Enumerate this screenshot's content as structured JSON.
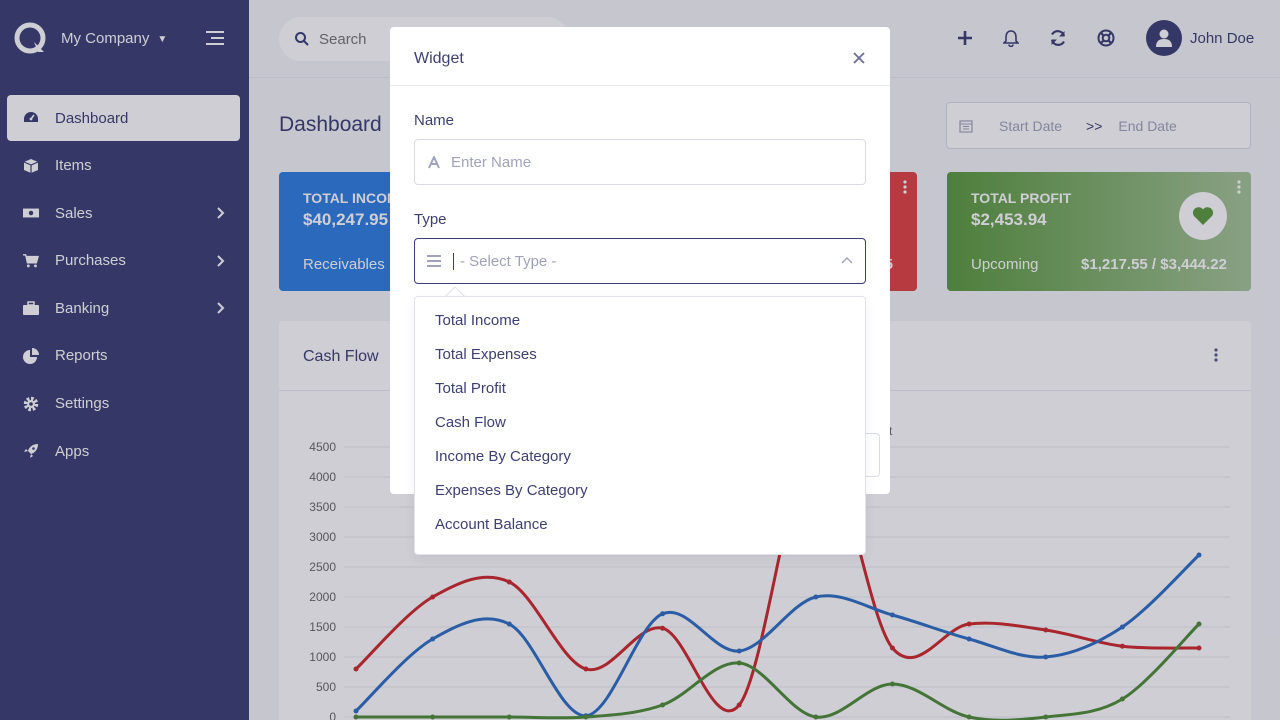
{
  "brand": {
    "name": "My Company",
    "logo_icon": "company-logo-icon"
  },
  "sidebar": {
    "items": [
      {
        "label": "Dashboard",
        "icon": "dashboard-icon",
        "active": true,
        "has_children": false
      },
      {
        "label": "Items",
        "icon": "cube-icon",
        "active": false,
        "has_children": false
      },
      {
        "label": "Sales",
        "icon": "money-icon",
        "active": false,
        "has_children": true
      },
      {
        "label": "Purchases",
        "icon": "cart-icon",
        "active": false,
        "has_children": true
      },
      {
        "label": "Banking",
        "icon": "briefcase-icon",
        "active": false,
        "has_children": true
      },
      {
        "label": "Reports",
        "icon": "pie-chart-icon",
        "active": false,
        "has_children": false
      },
      {
        "label": "Settings",
        "icon": "gear-icon",
        "active": false,
        "has_children": false
      },
      {
        "label": "Apps",
        "icon": "rocket-icon",
        "active": false,
        "has_children": false
      }
    ]
  },
  "header": {
    "search_placeholder": "Search",
    "user_name": "John Doe"
  },
  "dashboard": {
    "title": "Dashboard",
    "date_range": {
      "start_placeholder": "Start Date",
      "separator": ">>",
      "end_placeholder": "End Date"
    }
  },
  "cards": {
    "income": {
      "title": "TOTAL INCOM",
      "amount": "$40,247.95",
      "footer_left": "Receivables"
    },
    "expenses": {
      "footer_right_fragment": "5"
    },
    "profit": {
      "title": "TOTAL PROFIT",
      "amount": "$2,453.94",
      "footer_left": "Upcoming",
      "footer_right": "$1,217.55 / $3,444.22"
    }
  },
  "cash_flow": {
    "title": "Cash Flow",
    "legend_fragment": "fit"
  },
  "chart_data": {
    "type": "line",
    "title": "Cash Flow",
    "ylim": [
      0,
      4500
    ],
    "y_ticks": [
      "4500",
      "4000",
      "3500",
      "3000",
      "2500",
      "2000",
      "1500",
      "1000",
      "500",
      "0"
    ],
    "x_points": 12,
    "series": [
      {
        "color": "#d0282c",
        "values": [
          800,
          2000,
          2250,
          800,
          1480,
          200,
          4600,
          1150,
          1550,
          1450,
          1180,
          1150
        ]
      },
      {
        "color": "#2e6fc4",
        "values": [
          100,
          1300,
          1550,
          20,
          1720,
          1100,
          2000,
          1700,
          1300,
          1000,
          1500,
          2700
        ]
      },
      {
        "color": "#4f8d36",
        "values": [
          0,
          0,
          0,
          0,
          200,
          900,
          0,
          550,
          0,
          0,
          300,
          1550
        ]
      }
    ]
  },
  "modal": {
    "title": "Widget",
    "name_label": "Name",
    "name_placeholder": "Enter Name",
    "type_label": "Type",
    "type_placeholder": "- Select Type -",
    "type_options": [
      "Total Income",
      "Total Expenses",
      "Total Profit",
      "Cash Flow",
      "Income By Category",
      "Expenses By Category",
      "Account Balance"
    ]
  }
}
